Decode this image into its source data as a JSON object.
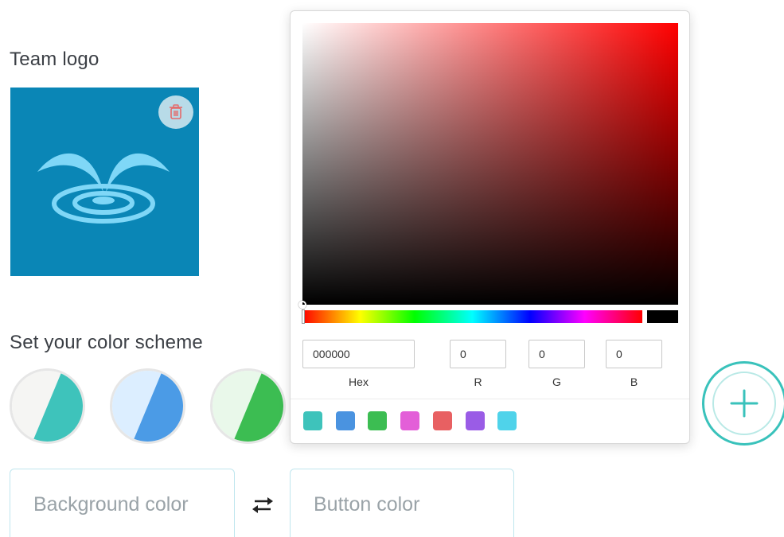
{
  "team_logo": {
    "label": "Team logo"
  },
  "color_scheme": {
    "label": "Set your color scheme",
    "schemes": [
      {
        "light": "#f5f5f3",
        "dark": "#3ec3bb"
      },
      {
        "light": "#dceeff",
        "dark": "#4b9be6"
      },
      {
        "light": "#e9f8ea",
        "dark": "#3cbd52"
      }
    ]
  },
  "fields": {
    "background_placeholder": "Background color",
    "button_placeholder": "Button color"
  },
  "picker": {
    "hex": "000000",
    "r": "0",
    "g": "0",
    "b": "0",
    "hex_label": "Hex",
    "r_label": "R",
    "g_label": "G",
    "b_label": "B",
    "current_color": "#000000",
    "presets": [
      "#3ec3bb",
      "#4a93e0",
      "#3cbd52",
      "#e35fd8",
      "#e86062",
      "#9a5ce6",
      "#4fd3ea"
    ]
  },
  "icons": {
    "delete": "trash-icon",
    "swap": "swap-arrows-icon",
    "add": "plus-icon"
  }
}
